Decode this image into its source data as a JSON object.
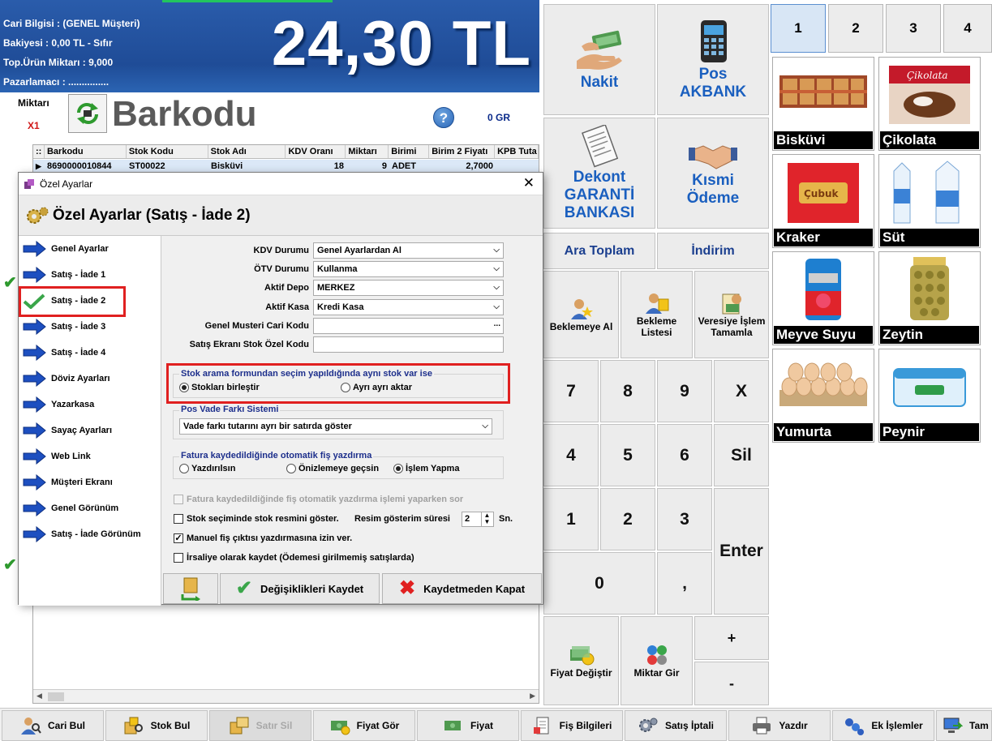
{
  "customer": {
    "cari_bilgisi": "Cari Bilgisi : (GENEL Müşteri)",
    "bakiyesi": "Bakiyesi : 0,00 TL - Sıfır",
    "top_urun": "Top.Ürün Miktarı : 9,000",
    "pazarlamaci": "Pazarlamacı : ..............."
  },
  "total": "24,30 TL",
  "quantity": {
    "label": "Miktarı",
    "value": "X1"
  },
  "search_mode_title": "Barkodu",
  "help_label": "?",
  "gram_label": "0 GR",
  "grid": {
    "columns": [
      "::",
      "Barkodu",
      "Stok Kodu",
      "Stok Adı",
      "KDV Oranı",
      "Miktarı",
      "Birimi",
      "Birim 2 Fiyatı",
      "KPB Tuta"
    ],
    "row": {
      "barkod": "8690000010844",
      "stok_kodu": "ST00022",
      "stok_adi": "Bisküvi",
      "kdv": "18",
      "miktar": "9",
      "birim": "ADET",
      "fiyat": "2,7000"
    }
  },
  "payment": {
    "nakit": "Nakit",
    "pos_line1": "Pos",
    "pos_line2": "AKBANK",
    "dekont_line1": "Dekont",
    "dekont_line2": "GARANTİ",
    "dekont_line3": "BANKASI",
    "kismi_line1": "Kısmi",
    "kismi_line2": "Ödeme",
    "ara_toplam": "Ara Toplam",
    "indirim": "İndirim",
    "beklemeye_al": "Beklemeye Al",
    "bekleme_listesi_1": "Bekleme",
    "bekleme_listesi_2": "Listesi",
    "veresiye_1": "Veresiye İşlem",
    "veresiye_2": "Tamamla",
    "fiyat_degistir": "Fiyat Değiştir",
    "miktar_gir": "Miktar Gir"
  },
  "keys": {
    "k7": "7",
    "k8": "8",
    "k9": "9",
    "kx": "X",
    "k4": "4",
    "k5": "5",
    "k6": "6",
    "sil": "Sil",
    "k1": "1",
    "k2": "2",
    "k3": "3",
    "enter": "Enter",
    "k0": "0",
    "comma": ",",
    "plus": "+",
    "minus": "-"
  },
  "tabs": [
    "1",
    "2",
    "3",
    "4"
  ],
  "products": [
    "Bisküvi",
    "Çikolata",
    "Kraker",
    "Süt",
    "Meyve Suyu",
    "Zeytin",
    "Yumurta",
    "Peynir"
  ],
  "bottom_bar": {
    "cari_bul": "Cari Bul",
    "stok_bul": "Stok Bul",
    "satir_sil": "Satır Sil",
    "fiyat_gor": "Fiyat Gör",
    "fiyat": "Fiyat",
    "fis_bilgileri": "Fiş Bilgileri",
    "satis_iptali": "Satış İptali",
    "yazdir": "Yazdır",
    "ek_islemler": "Ek İşlemler",
    "tam": "Tam"
  },
  "dialog": {
    "window_title": "Özel Ayarlar",
    "close": "✕",
    "header": "Özel Ayarlar (Satış - İade 2)",
    "nav": [
      "Genel Ayarlar",
      "Satış - İade 1",
      "Satış - İade 2",
      "Satış - İade 3",
      "Satış - İade 4",
      "Döviz Ayarları",
      "Yazarkasa",
      "Sayaç Ayarları",
      "Web Link",
      "Müşteri Ekranı",
      "Genel Görünüm",
      "Satış - İade Görünüm"
    ],
    "fields": {
      "kdv_label": "KDV Durumu",
      "kdv_value": "Genel Ayarlardan Al",
      "otv_label": "ÖTV Durumu",
      "otv_value": "Kullanma",
      "depo_label": "Aktif Depo",
      "depo_value": "MERKEZ",
      "kasa_label": "Aktif Kasa",
      "kasa_value": "Kredi Kasa",
      "musteri_label": "Genel Musteri Cari Kodu",
      "musteri_btn": "...",
      "stok_ozel_label": "Satış Ekranı Stok Özel Kodu"
    },
    "stock_group": {
      "title": "Stok arama formundan seçim yapıldığında aynı stok var ise",
      "opt1": "Stokları birleştir",
      "opt2": "Ayrı ayrı aktar"
    },
    "pos_group": {
      "title": "Pos Vade Farkı Sistemi",
      "value": "Vade farkı tutarını ayrı bir satırda göster"
    },
    "print_group": {
      "title": "Fatura kaydedildiğinde otomatik fiş yazdırma",
      "opt1": "Yazdırılsın",
      "opt2": "Önizlemeye geçsin",
      "opt3": "İşlem Yapma"
    },
    "checks": {
      "c1": "Fatura kaydedildiğinde fiş otomatik yazdırma işlemi yaparken sor",
      "c2": "Stok seçiminde stok resmini göster.",
      "c2_extra": "Resim gösterim süresi",
      "c2_value": "2",
      "c2_unit": "Sn.",
      "c3": "Manuel fiş çıktısı yazdırmasına izin ver.",
      "c4": "İrsaliye olarak kaydet (Ödemesi girilmemiş satışlarda)"
    },
    "buttons": {
      "save": "Değişiklikleri Kaydet",
      "close": "Kaydetmeden Kapat"
    }
  },
  "colors": {
    "header_blue": "#1f4c97",
    "accent_blue": "#1a5fbf",
    "highlight_red": "#e02020",
    "active_tab": "#d8e6f5"
  }
}
